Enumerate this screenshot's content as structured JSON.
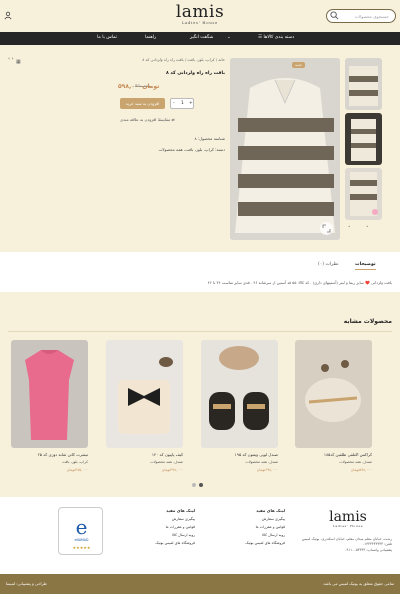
{
  "header": {
    "search_placeholder": "جستجوی محصولات",
    "logo_word": "lamis",
    "logo_tagline": "Ladies' House"
  },
  "nav": {
    "categories": "دسته بندی کالاها",
    "shop": "شگفت انگیز",
    "guide": "راهنما",
    "contact": "تماس با ما"
  },
  "product": {
    "breadcrumb": "خانه / کراپ، بلوز، بافت / بافت راه راه ولزدانی کد ۸",
    "title": "بافت راه راه ولزدانی کد ۸",
    "new_badge": "جدید",
    "price_old": "۹۵۰,۰۰۰",
    "price_new": "۵۹۸,۰۰۰تومان",
    "qty": "1",
    "add_to_cart": "افزودن به سبد خرید",
    "compare": "مقایسه",
    "wishlist": "افزودن به علاقه مندی",
    "sku": "شناسه محصول: ۸",
    "category": "دسته: کراپ، بلوز، بافت، همه محصولات"
  },
  "tabs": {
    "description": "توضیحات",
    "reviews": "نظرات (۰)",
    "description_text": "بافت ولزدانی ❤️ سایز ریما و لیتر (آستینهای داری) . کد کالا: ۵۵ قد آستین از سرشانه ۴۶ . قدی سایز مناسب ۳۶ تا ۴۶"
  },
  "related": {
    "title": "محصولات مشابه",
    "items": [
      {
        "name": "کراکس اکتلفی ظلفین کد۱۸۵",
        "cat": "صندل، همه محصولات",
        "price": "۵۹۸,۰۰۰تومان"
      },
      {
        "name": "صندل لوپی ویتتون کد ۱۹۵",
        "cat": "صندل، همه محصولات",
        "price": "۶۹۸,۰۰۰تومان"
      },
      {
        "name": "کیف پاپیون کد ۱۴۰",
        "cat": "صندل، همه محصولات",
        "price": "۳۹۸,۰۰۰تومان"
      },
      {
        "name": "تیشرت کاتن شانه دوزی کد ۲۵",
        "cat": "کراپ، بلوز، بافت",
        "price": "۳۸۵,۰۰۰تومان"
      }
    ]
  },
  "footer": {
    "logo_word": "lamis",
    "logo_tagline": "Ladies' House",
    "about": "رشت، خیابان معلم میدان معلم، خیابان اسکندری، بوتیک لمیس",
    "phone": "تلفن: ۰۱۳۳۳۳۳۳۳۳۳",
    "mobile": "پشتیبانی واتساپ: ۰۹۱۱۰۰۵۳۳۴۳",
    "links1_title": "لینک های مفید",
    "links1": [
      "پیگیری سفارش",
      "قوانین و مقررات ما",
      "رویه ارسال کالا",
      "فروشگاه های لمیس بوتیک"
    ],
    "links2_title": "لینک های مفید",
    "links2": [
      "پیگیری سفارش",
      "قوانین و مقررات ما",
      "رویه ارسال کالا",
      "فروشگاه های لمیس بوتیک"
    ],
    "enamad_label": "eNAMAD",
    "copyright": "تمامی حقوق متعلق به بوتیک لمیس می باشد.",
    "designer": "طراحی و پشتیبانی: لمیسا"
  },
  "colors": {
    "accent": "#c9a46e",
    "nav_bg": "#262626",
    "page_bg": "#f7f1dc",
    "bottom_bar": "#8a7644"
  }
}
